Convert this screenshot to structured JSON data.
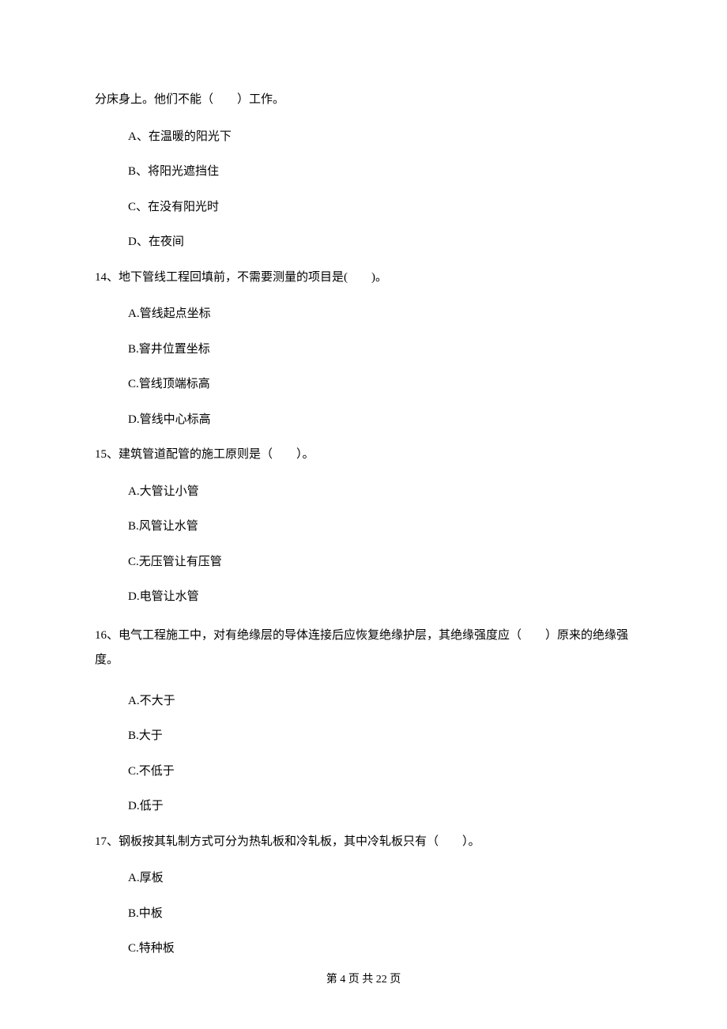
{
  "q13_continued": {
    "stem": "分床身上。他们不能（　　）工作。",
    "options": {
      "a": "A、在温暖的阳光下",
      "b": "B、将阳光遮挡住",
      "c": "C、在没有阳光时",
      "d": "D、在夜间"
    }
  },
  "q14": {
    "stem": "14、地下管线工程回填前，不需要测量的项目是(　　)。",
    "options": {
      "a": "A.管线起点坐标",
      "b": "B.窨井位置坐标",
      "c": "C.管线顶端标高",
      "d": "D.管线中心标高"
    }
  },
  "q15": {
    "stem": "15、建筑管道配管的施工原则是（　　）。",
    "options": {
      "a": "A.大管让小管",
      "b": "B.风管让水管",
      "c": "C.无压管让有压管",
      "d": "D.电管让水管"
    }
  },
  "q16": {
    "stem": "16、电气工程施工中，对有绝缘层的导体连接后应恢复绝缘护层，其绝缘强度应（　　）原来的绝缘强度。",
    "options": {
      "a": "A.不大于",
      "b": "B.大于",
      "c": "C.不低于",
      "d": "D.低于"
    }
  },
  "q17": {
    "stem": "17、钢板按其轧制方式可分为热轧板和冷轧板，其中冷轧板只有（　　）。",
    "options": {
      "a": "A.厚板",
      "b": "B.中板",
      "c": "C.特种板"
    }
  },
  "footer": "第 4 页 共 22 页"
}
